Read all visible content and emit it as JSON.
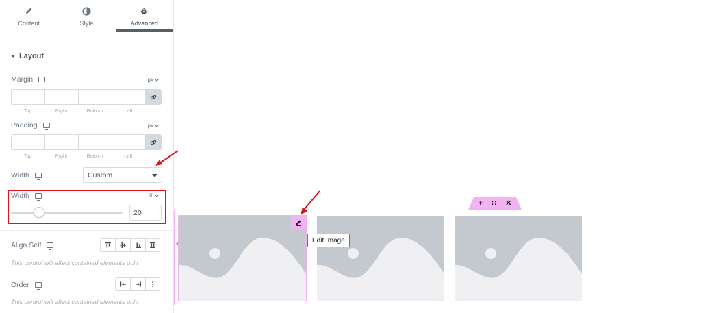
{
  "tabs": [
    {
      "label": "Content",
      "icon": "pencil-icon"
    },
    {
      "label": "Style",
      "icon": "half-circle-icon"
    },
    {
      "label": "Advanced",
      "icon": "gear-icon",
      "active": true
    }
  ],
  "section": {
    "title": "Layout"
  },
  "margin": {
    "label": "Margin",
    "unit": "px",
    "sides": [
      "Top",
      "Right",
      "Bottom",
      "Left"
    ]
  },
  "padding": {
    "label": "Padding",
    "unit": "px",
    "sides": [
      "Top",
      "Right",
      "Bottom",
      "Left"
    ]
  },
  "width_select": {
    "label": "Width",
    "value": "Custom"
  },
  "width_slider": {
    "label": "Width",
    "unit": "%",
    "value": "20",
    "fraction": 0.2
  },
  "align_self": {
    "label": "Align Self",
    "note": "This control will affect contained elements only."
  },
  "order": {
    "label": "Order",
    "note": "This control will affect contained elements only."
  },
  "canvas": {
    "handle_icons": [
      "plus-icon",
      "drag-handle-icon",
      "close-icon"
    ],
    "handle_glyphs": [
      "+",
      "∷",
      "✕"
    ],
    "tooltip": "Edit Image"
  },
  "colors": {
    "accent_pink": "#f1b3f3",
    "annotation_red": "#e0121b",
    "placeholder_gray": "#c4c9cf"
  }
}
